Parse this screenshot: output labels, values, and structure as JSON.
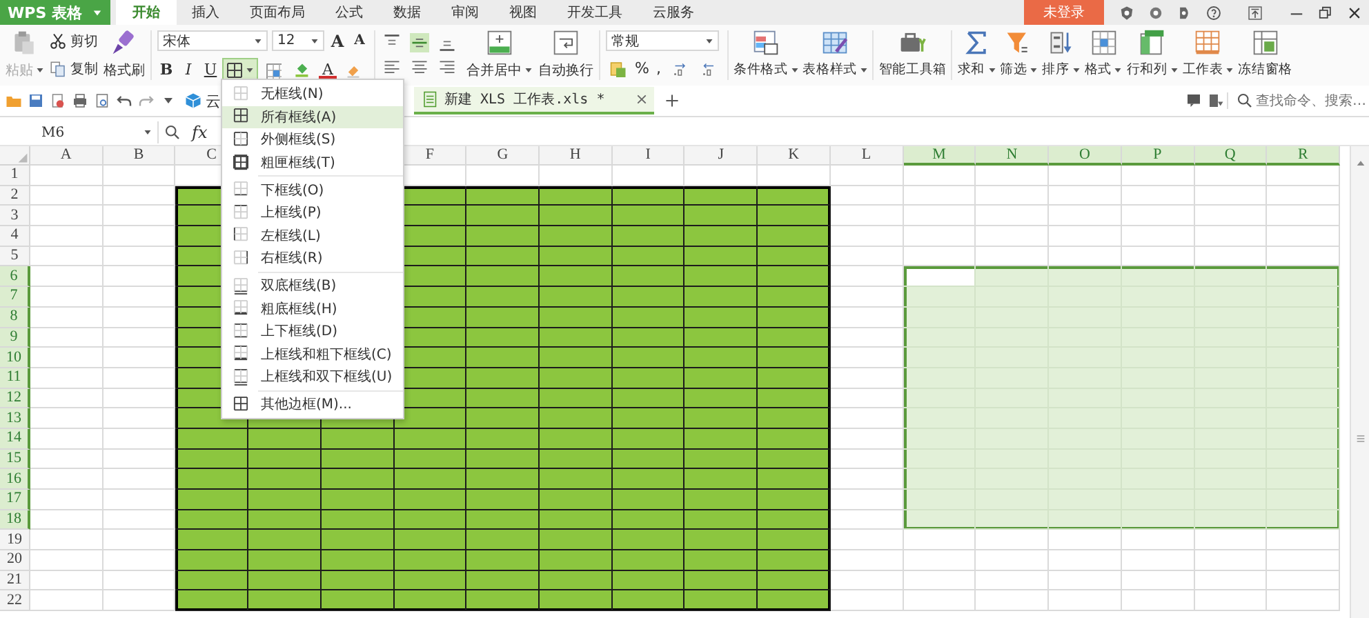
{
  "app_button": {
    "label": "WPS 表格"
  },
  "menu_tabs": [
    {
      "label": "开始",
      "selected": true
    },
    {
      "label": "插入",
      "selected": false
    },
    {
      "label": "页面布局",
      "selected": false
    },
    {
      "label": "公式",
      "selected": false
    },
    {
      "label": "数据",
      "selected": false
    },
    {
      "label": "审阅",
      "selected": false
    },
    {
      "label": "视图",
      "selected": false
    },
    {
      "label": "开发工具",
      "selected": false
    },
    {
      "label": "云服务",
      "selected": false
    }
  ],
  "account": {
    "label": "未登录"
  },
  "ribbon": {
    "paste": {
      "label": "粘贴",
      "disabled": true
    },
    "clipboard": [
      {
        "label": "剪切",
        "kind": "cut"
      },
      {
        "label": "复制",
        "kind": "copy"
      }
    ],
    "format_painter": {
      "label": "格式刷"
    },
    "font": {
      "name": "宋体",
      "size": "12",
      "grow": "A",
      "shrink": "A",
      "styles": [
        "B",
        "I",
        "U"
      ],
      "font_color": "A"
    },
    "border_button": {
      "expanded": true
    },
    "alignment": [
      {
        "kind": "top",
        "selected": false
      },
      {
        "kind": "middle",
        "selected": true
      },
      {
        "kind": "bottom",
        "selected": false
      },
      {
        "kind": "left",
        "selected": false
      },
      {
        "kind": "center",
        "selected": false
      },
      {
        "kind": "right",
        "selected": false
      }
    ],
    "cell_buttons": [
      {
        "label": "合并居中",
        "kind": "merge",
        "has_menu": true
      },
      {
        "label": "自动换行",
        "kind": "wrap",
        "has_menu": false
      }
    ],
    "number": {
      "format": "常规",
      "percent": "%",
      "comma": ","
    },
    "tools": [
      {
        "label": "条件格式",
        "kind": "conditional",
        "has_menu": true
      },
      {
        "label": "表格样式",
        "kind": "table_style",
        "has_menu": true
      },
      {
        "label": "智能工具箱",
        "kind": "toolbox",
        "has_menu": false
      },
      {
        "label": "求和",
        "kind": "sum",
        "has_menu": true
      },
      {
        "label": "筛选",
        "kind": "filter",
        "has_menu": true
      },
      {
        "label": "排序",
        "kind": "sort",
        "has_menu": true
      },
      {
        "label": "格式",
        "kind": "format",
        "has_menu": true
      },
      {
        "label": "行和列",
        "kind": "rows_cols",
        "has_menu": true
      },
      {
        "label": "工作表",
        "kind": "sheet",
        "has_menu": true
      },
      {
        "label": "冻结窗格",
        "kind": "freeze",
        "has_menu": false
      }
    ]
  },
  "quick_access": {
    "cloud": "云"
  },
  "document_tabs": [
    {
      "title": "新建 XLS 工作表.xls *",
      "selected": true
    }
  ],
  "command_search": {
    "placeholder": "查找命令、搜索…"
  },
  "formula_bar": {
    "name_box": "M6",
    "fx": "fx"
  },
  "sheet": {
    "columns": [
      {
        "label": "A",
        "selected": false,
        "filled": false
      },
      {
        "label": "B",
        "selected": false,
        "filled": false
      },
      {
        "label": "C",
        "selected": false,
        "filled": true
      },
      {
        "filled": true
      },
      {
        "filled": true
      },
      {
        "label": "F",
        "selected": false,
        "filled": true
      },
      {
        "label": "G",
        "selected": false,
        "filled": true
      },
      {
        "label": "H",
        "selected": false,
        "filled": true
      },
      {
        "label": "I",
        "selected": false,
        "filled": true
      },
      {
        "label": "J",
        "selected": false,
        "filled": true
      },
      {
        "label": "K",
        "selected": false,
        "filled": true
      },
      {
        "label": "L",
        "selected": false,
        "filled": false
      },
      {
        "label": "M",
        "selected": true,
        "filled": false
      },
      {
        "label": "N",
        "selected": true,
        "filled": false
      },
      {
        "label": "O",
        "selected": true,
        "filled": false
      },
      {
        "label": "P",
        "selected": true,
        "filled": false
      },
      {
        "label": "Q",
        "selected": true,
        "filled": false
      },
      {
        "label": "R",
        "selected": true,
        "filled": false
      }
    ],
    "rows": [
      {
        "label": "1",
        "selected": false,
        "filled": false
      },
      {
        "label": "2",
        "selected": false,
        "filled": true
      },
      {
        "label": "3",
        "selected": false,
        "filled": true
      },
      {
        "label": "4",
        "selected": false,
        "filled": true
      },
      {
        "label": "5",
        "selected": false,
        "filled": true
      },
      {
        "label": "6",
        "selected": true,
        "filled": true
      },
      {
        "label": "7",
        "selected": true,
        "filled": true
      },
      {
        "label": "8",
        "selected": true,
        "filled": true
      },
      {
        "label": "9",
        "selected": true,
        "filled": true
      },
      {
        "label": "10",
        "selected": true,
        "filled": true
      },
      {
        "label": "11",
        "selected": true,
        "filled": true
      },
      {
        "label": "12",
        "selected": true,
        "filled": true
      },
      {
        "label": "13",
        "selected": true,
        "filled": true
      },
      {
        "label": "14",
        "selected": true,
        "filled": true
      },
      {
        "label": "15",
        "selected": true,
        "filled": true
      },
      {
        "label": "16",
        "selected": true,
        "filled": true
      },
      {
        "label": "17",
        "selected": true,
        "filled": true
      },
      {
        "label": "18",
        "selected": true,
        "filled": true
      },
      {
        "label": "19",
        "selected": false,
        "filled": true
      },
      {
        "label": "20",
        "selected": false,
        "filled": true
      },
      {
        "label": "21",
        "selected": false,
        "filled": true
      },
      {
        "label": "22",
        "selected": false,
        "filled": true
      }
    ]
  },
  "border_menu": {
    "groups": [
      [
        {
          "label": "无框线(N)",
          "kind": "none",
          "selected": false
        },
        {
          "label": "所有框线(A)",
          "kind": "all",
          "selected": true
        },
        {
          "label": "外侧框线(S)",
          "kind": "outside",
          "selected": false
        },
        {
          "label": "粗匣框线(T)",
          "kind": "thick_box",
          "selected": false
        }
      ],
      [
        {
          "label": "下框线(O)",
          "kind": "bottom",
          "selected": false
        },
        {
          "label": "上框线(P)",
          "kind": "top",
          "selected": false
        },
        {
          "label": "左框线(L)",
          "kind": "left",
          "selected": false
        },
        {
          "label": "右框线(R)",
          "kind": "right",
          "selected": false
        }
      ],
      [
        {
          "label": "双底框线(B)",
          "kind": "double_bottom",
          "selected": false
        },
        {
          "label": "粗底框线(H)",
          "kind": "thick_bottom",
          "selected": false
        },
        {
          "label": "上下框线(D)",
          "kind": "top_bottom",
          "selected": false
        },
        {
          "label": "上框线和粗下框线(C)",
          "kind": "top_thick_bottom",
          "selected": false
        },
        {
          "label": "上框线和双下框线(U)",
          "kind": "top_double_bottom",
          "selected": false
        }
      ],
      [
        {
          "label": "其他边框(M)...",
          "kind": "more",
          "selected": false
        }
      ]
    ]
  }
}
